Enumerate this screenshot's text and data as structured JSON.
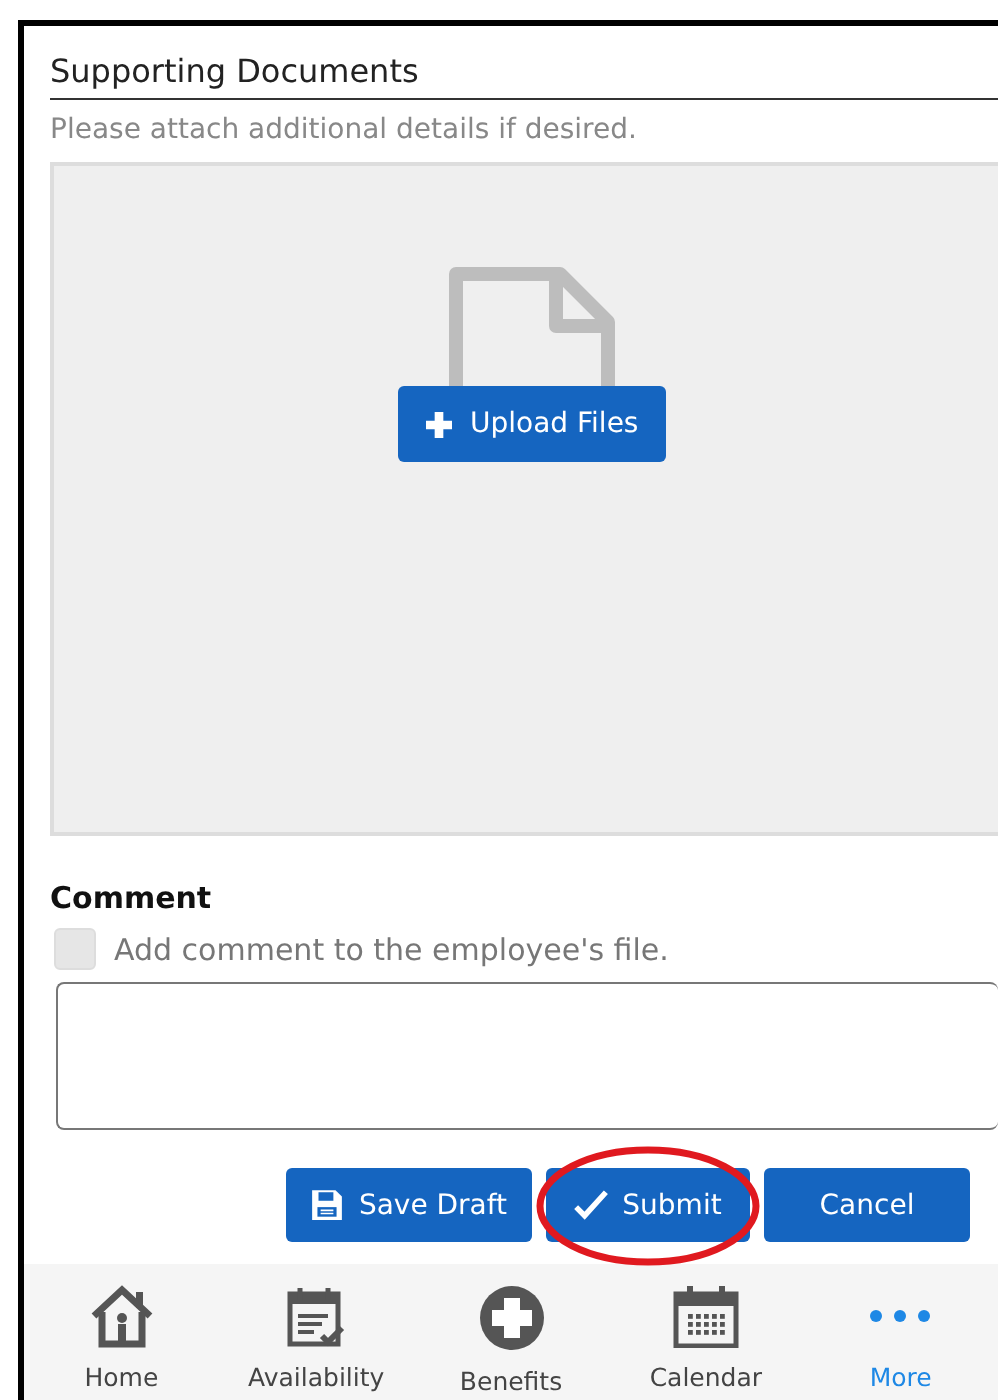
{
  "section": {
    "title": "Supporting Documents",
    "hint": "Please attach additional details if desired."
  },
  "upload": {
    "button": "Upload Files"
  },
  "comment": {
    "label": "Comment",
    "checkbox": {
      "label": "Add comment to the employee's file.",
      "checked": false
    }
  },
  "actions": [
    {
      "kind": "save",
      "label": "Save Draft",
      "highlighted": false
    },
    {
      "kind": "submit",
      "label": "Submit",
      "highlighted": true
    },
    {
      "kind": "cancel",
      "label": "Cancel",
      "highlighted": false
    }
  ],
  "nav": [
    {
      "kind": "home",
      "label": "Home",
      "selected": false
    },
    {
      "kind": "availability",
      "label": "Availability",
      "selected": false
    },
    {
      "kind": "benefits",
      "label": "Benefits",
      "selected": false
    },
    {
      "kind": "calendar",
      "label": "Calendar",
      "selected": false
    },
    {
      "kind": "more",
      "label": "More",
      "selected": true
    }
  ]
}
